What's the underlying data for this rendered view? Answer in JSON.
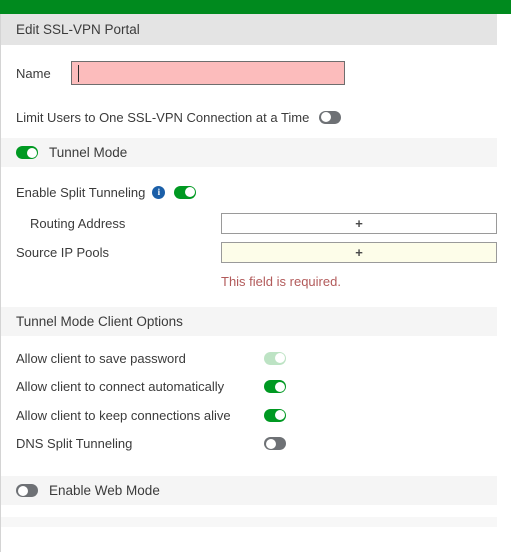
{
  "topbar": {
    "color": "#008a1e"
  },
  "title": {
    "text": "Edit SSL-VPN Portal"
  },
  "name_field": {
    "label": "Name",
    "value": "",
    "placeholder": "",
    "state": "invalid",
    "bg_color": "#fcbcbc"
  },
  "limit_users": {
    "label": "Limit Users to One SSL-VPN Connection at a Time",
    "toggle_state": "off"
  },
  "tunnel_mode": {
    "label": "Tunnel Mode",
    "toggle_state": "on"
  },
  "split_tunneling": {
    "label": "Enable Split Tunneling",
    "info_icon": "info-icon",
    "info_glyph": "i",
    "toggle_state": "on"
  },
  "routing_address": {
    "label": "Routing Address",
    "button_glyph": "+",
    "state": "normal"
  },
  "source_ip_pools": {
    "label": "Source IP Pools",
    "button_glyph": "+",
    "state": "invalid",
    "error": "This field is required."
  },
  "client_options": {
    "header": "Tunnel Mode Client Options",
    "items": [
      {
        "label": "Allow client to save password",
        "toggle_state": "on-disabled"
      },
      {
        "label": "Allow client to connect automatically",
        "toggle_state": "on"
      },
      {
        "label": "Allow client to keep connections alive",
        "toggle_state": "on"
      },
      {
        "label": "DNS Split Tunneling",
        "toggle_state": "off"
      }
    ]
  },
  "web_mode": {
    "label": "Enable Web Mode",
    "toggle_state": "off"
  },
  "colors": {
    "accent_green": "#008a1e",
    "toggle_on": "#009922",
    "toggle_off": "#6e7175",
    "toggle_on_disabled": "#bde3c4",
    "error_text": "#b25a5a",
    "invalid_field_bg": "#fcbcbc",
    "invalid_button_bg": "#fdfde9",
    "info_blue": "#1b5fa8",
    "title_band_bg": "#e4e4e4",
    "section_band_bg": "#f5f5f5"
  }
}
